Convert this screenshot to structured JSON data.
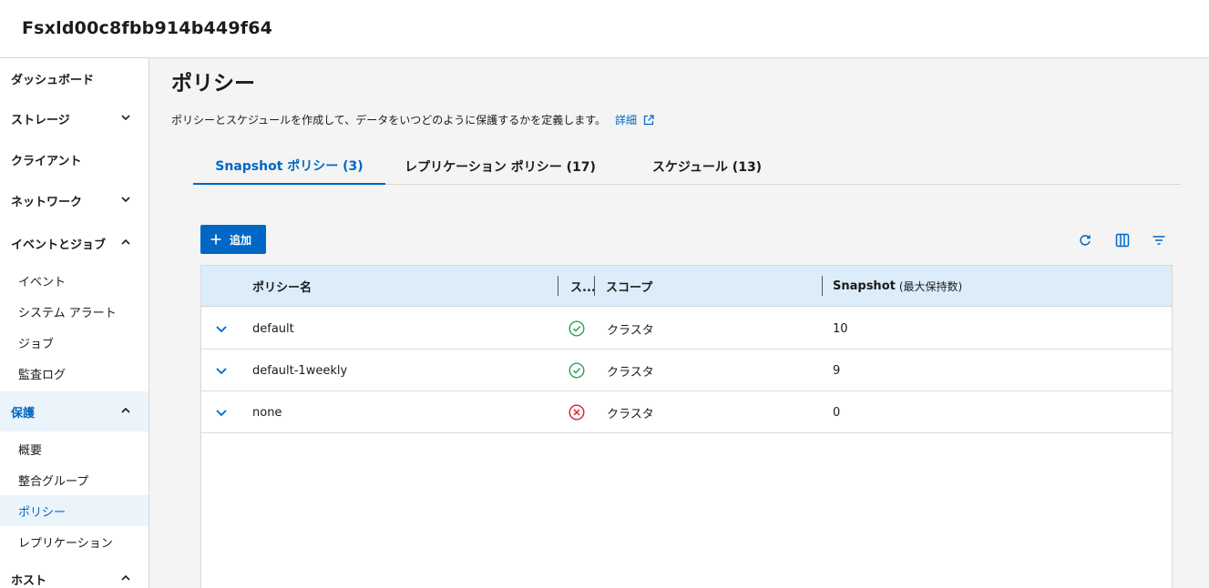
{
  "header": {
    "title": "Fsxld00c8fbb914b449f64"
  },
  "sidebar": {
    "items": [
      {
        "label": "ダッシュボード",
        "chevron": ""
      },
      {
        "label": "ストレージ",
        "chevron": "down"
      },
      {
        "label": "クライアント",
        "chevron": ""
      },
      {
        "label": "ネットワーク",
        "chevron": "down"
      },
      {
        "label": "イベントとジョブ",
        "chevron": "up"
      },
      {
        "label": "保護",
        "chevron": "up"
      },
      {
        "label": "ホスト",
        "chevron": "up"
      }
    ],
    "events_sub": [
      "イベント",
      "システム アラート",
      "ジョブ",
      "監査ログ"
    ],
    "protection_sub": [
      "概要",
      "整合グループ",
      "ポリシー",
      "レプリケーション"
    ]
  },
  "main": {
    "title": "ポリシー",
    "description": "ポリシーとスケジュールを作成して、データをいつどのように保護するかを定義します。",
    "details_link": "詳細",
    "tabs": [
      {
        "label": "Snapshot ポリシー (3)"
      },
      {
        "label": "レプリケーション ポリシー (17)"
      },
      {
        "label": "スケジュール (13)"
      }
    ],
    "add_button": "追加",
    "table": {
      "headers": {
        "name": "ポリシー名",
        "status": "ス...",
        "scope": "スコープ",
        "snapshot": "Snapshot",
        "snapshot_sub": "(最大保持数)"
      },
      "rows": [
        {
          "name": "default",
          "status": "ok",
          "scope": "クラスタ",
          "snapshot": "10"
        },
        {
          "name": "default-1weekly",
          "status": "ok",
          "scope": "クラスタ",
          "snapshot": "9"
        },
        {
          "name": "none",
          "status": "error",
          "scope": "クラスタ",
          "snapshot": "0"
        }
      ]
    }
  },
  "colors": {
    "accent": "#0067c5",
    "ok": "#2e9e5b",
    "error": "#d2222d",
    "header_bg": "#dcedf9"
  }
}
